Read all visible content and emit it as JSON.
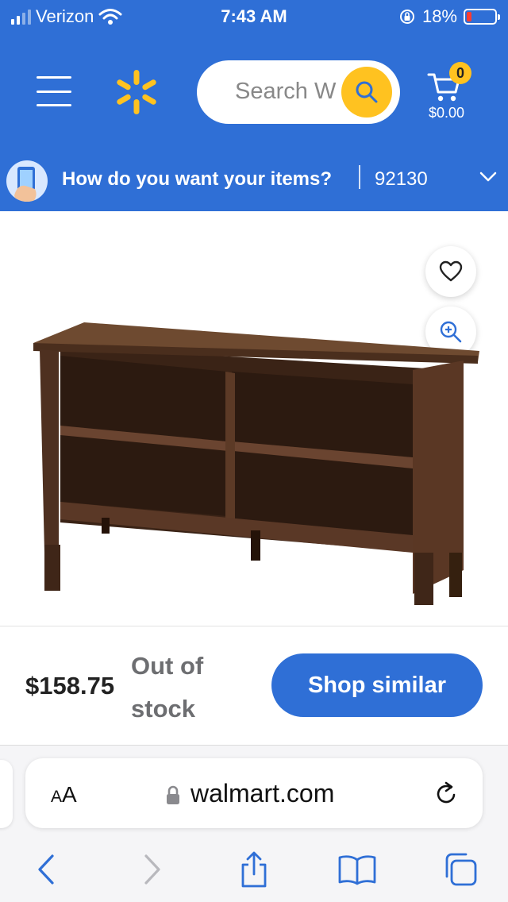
{
  "status_bar": {
    "carrier": "Verizon",
    "time": "7:43 AM",
    "battery": "18%",
    "battery_level": 0.18
  },
  "header": {
    "search_placeholder": "Search W",
    "cart_count": "0",
    "cart_total": "$0.00",
    "icons": [
      "menu-icon",
      "walmart-spark-icon",
      "search-icon",
      "cart-icon"
    ]
  },
  "delivery": {
    "question": "How do you want your items?",
    "zip": "92130"
  },
  "product": {
    "price": "$158.75",
    "stock_line1": "Out of",
    "stock_line2": "stock",
    "cta": "Shop similar"
  },
  "browser": {
    "aa_small": "A",
    "aa_large": "A",
    "url": "walmart.com"
  },
  "colors": {
    "brand_blue": "#2f6fd6",
    "brand_yellow": "#ffc220",
    "battery_red": "#ff3b30"
  }
}
